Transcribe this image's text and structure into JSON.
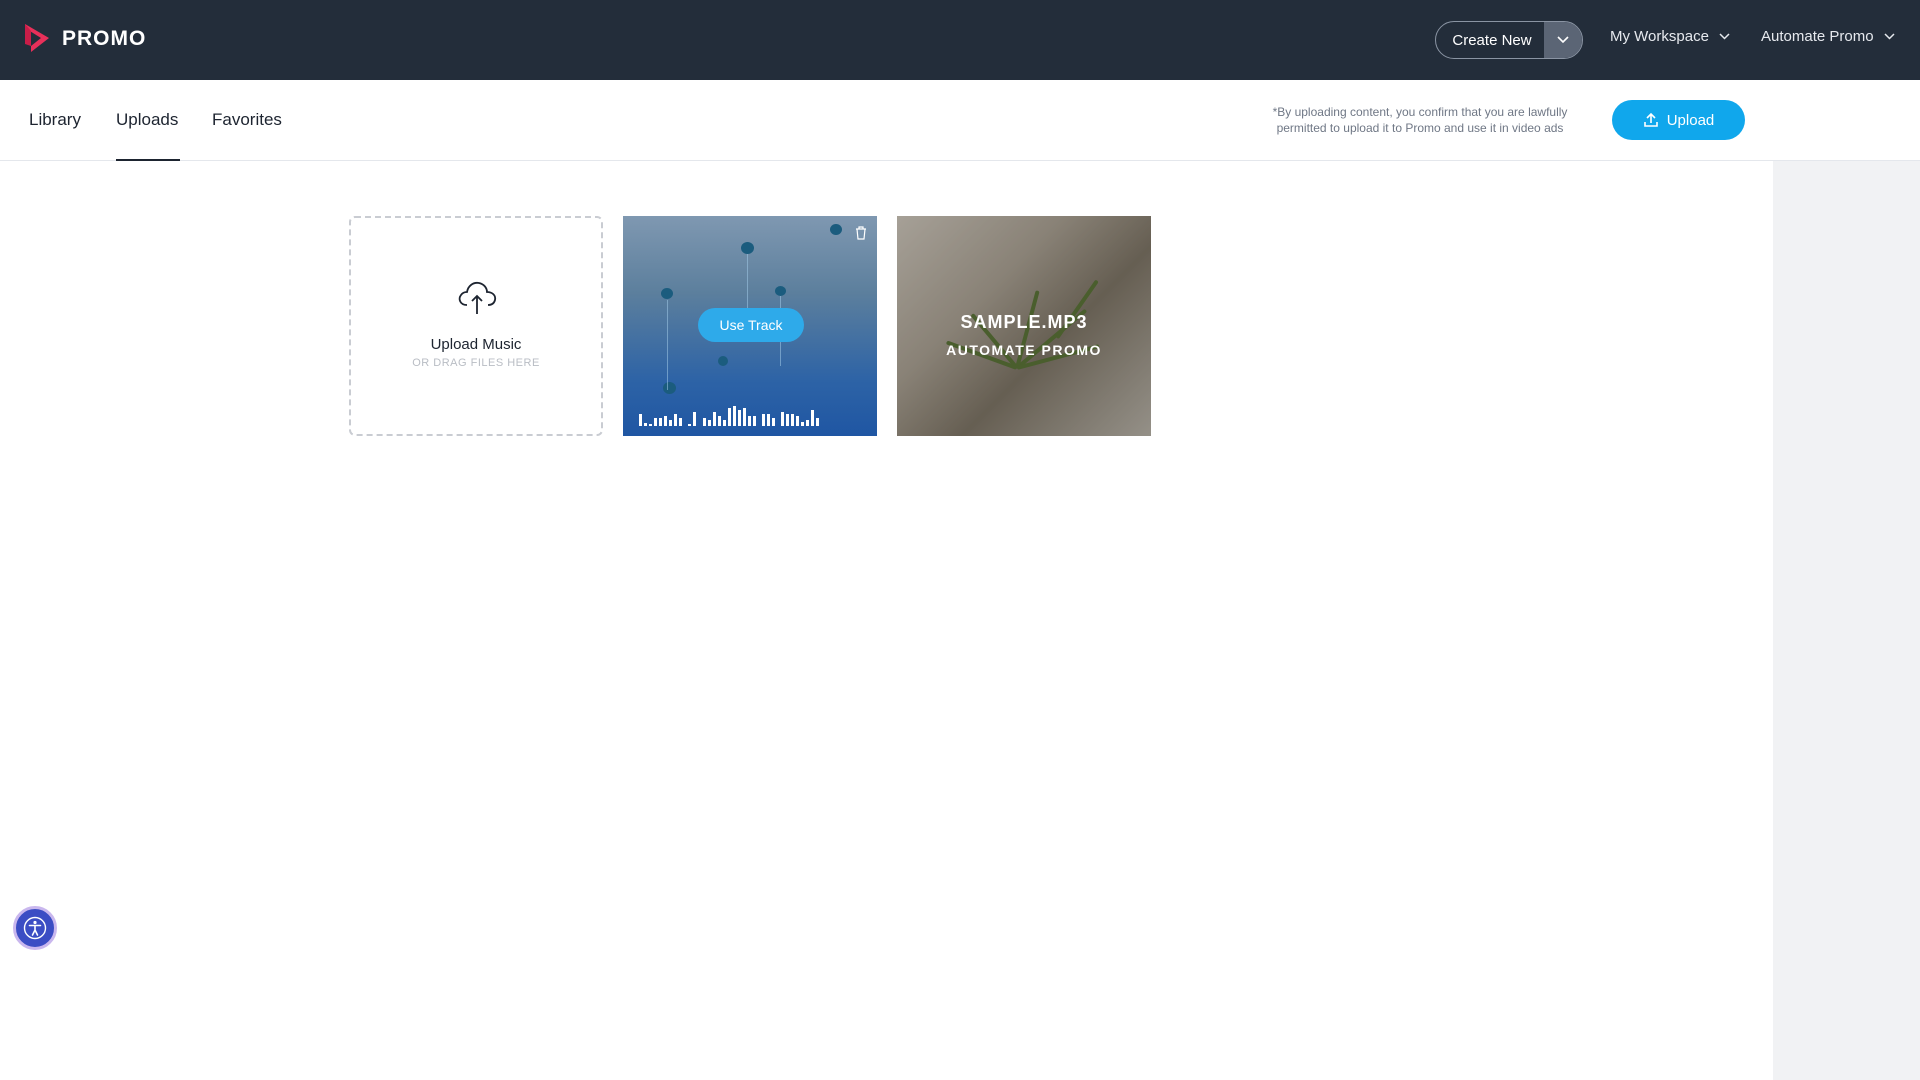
{
  "header": {
    "logo_text": "PROMO",
    "create_new_label": "Create New",
    "workspace_label": "My Workspace",
    "account_label": "Automate Promo"
  },
  "tabs": [
    {
      "label": "Library",
      "active": false
    },
    {
      "label": "Uploads",
      "active": true
    },
    {
      "label": "Favorites",
      "active": false
    }
  ],
  "disclaimer": "*By uploading content, you confirm that you are lawfully permitted to upload it to Promo and use it in video ads",
  "upload_button_label": "Upload",
  "upload_card": {
    "title": "Upload Music",
    "subtitle": "OR DRAG FILES HERE"
  },
  "track_card": {
    "use_track_label": "Use Track"
  },
  "sample_card": {
    "title": "SAMPLE.MP3",
    "subtitle": "AUTOMATE PROMO"
  },
  "colors": {
    "topbar": "#232d3a",
    "accent": "#10a7ec",
    "logo": "#e8305a"
  },
  "icons": [
    "promo-logo-icon",
    "chevron-down-icon",
    "upload-icon",
    "cloud-upload-icon",
    "trash-icon",
    "accessibility-icon"
  ]
}
